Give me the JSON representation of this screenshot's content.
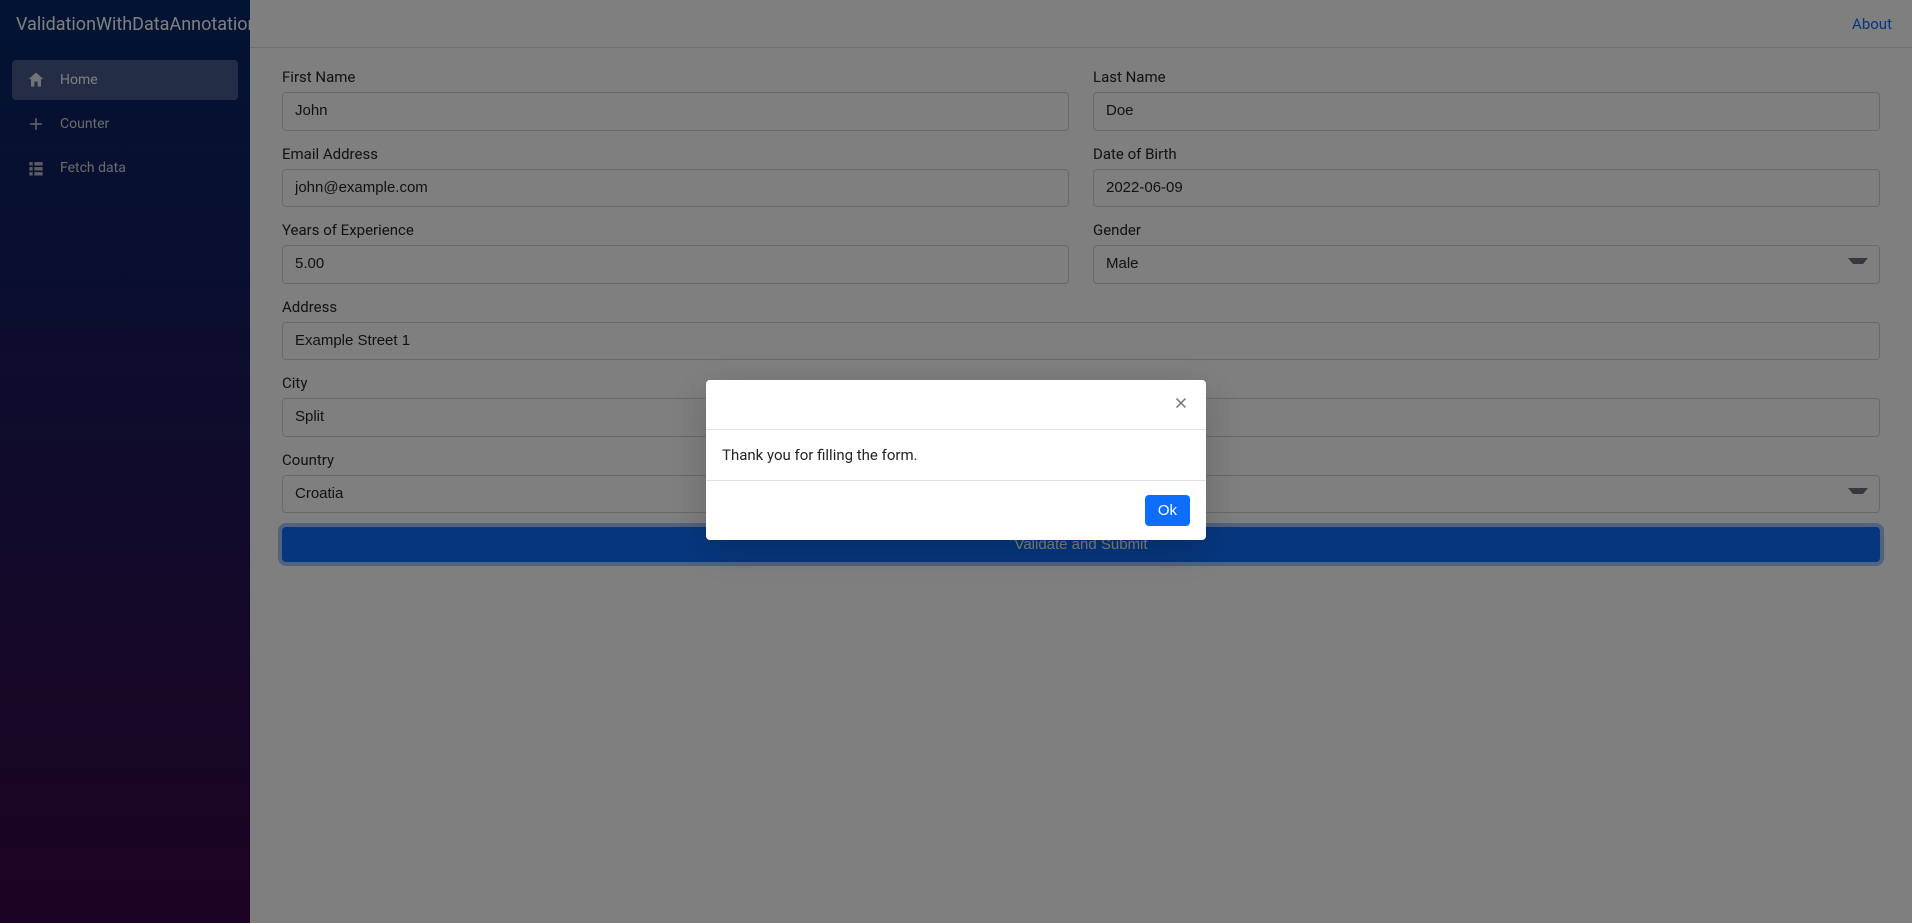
{
  "brand": "ValidationWithDataAnnotation",
  "topbar": {
    "about": "About"
  },
  "sidebar": {
    "items": [
      {
        "label": "Home",
        "icon": "home-icon",
        "active": true
      },
      {
        "label": "Counter",
        "icon": "plus-icon",
        "active": false
      },
      {
        "label": "Fetch data",
        "icon": "list-icon",
        "active": false
      }
    ]
  },
  "form": {
    "firstName": {
      "label": "First Name",
      "value": "John"
    },
    "lastName": {
      "label": "Last Name",
      "value": "Doe"
    },
    "email": {
      "label": "Email Address",
      "value": "john@example.com"
    },
    "dob": {
      "label": "Date of Birth",
      "value": "2022-06-09"
    },
    "experience": {
      "label": "Years of Experience",
      "value": "5.00"
    },
    "gender": {
      "label": "Gender",
      "value": "Male"
    },
    "address": {
      "label": "Address",
      "value": "Example Street 1"
    },
    "city": {
      "label": "City",
      "value": "Split"
    },
    "country": {
      "label": "Country",
      "value": "Croatia"
    },
    "submit": "Validate and Submit"
  },
  "modal": {
    "body": "Thank you for filling the form.",
    "ok": "Ok"
  }
}
